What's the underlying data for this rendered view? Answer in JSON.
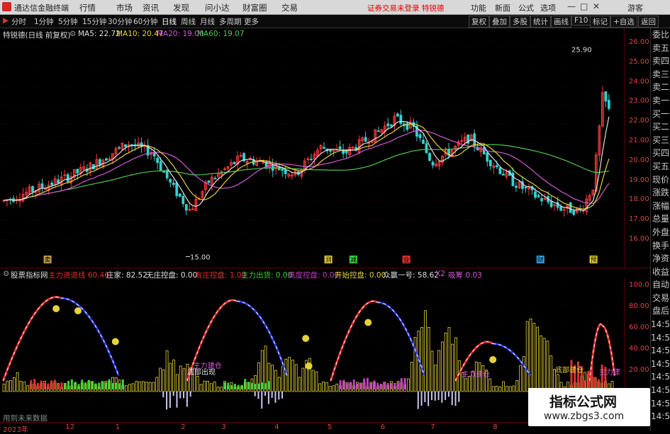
{
  "menubar": {
    "title": "通达信金融终端",
    "items": [
      "行情",
      "市场",
      "资讯",
      "发现",
      "问小达",
      "财富圈",
      "交易"
    ],
    "warning": "证券交易未登录 特锐德",
    "right": [
      "功能",
      "新面",
      "公式",
      "选项"
    ],
    "guest": "游客"
  },
  "toolbar": {
    "periods": [
      "分时",
      "1分钟",
      "5分钟",
      "15分钟",
      "30分钟",
      "60分钟",
      "日线",
      "周线",
      "月线",
      "多周期",
      "更多"
    ],
    "active": "日线",
    "right_buttons": [
      "复权",
      "叠加",
      "多股",
      "统计",
      "画线",
      "F10",
      "标记",
      "+自选",
      "返回"
    ]
  },
  "info": {
    "stock": "特锐德(日线 前复权)",
    "ma5": "MA5: 22.72",
    "ma10": "MA10: 20.47",
    "ma20": "MA20: 19.00",
    "ma60": "MA60: 19.07",
    "colors": {
      "ma5": "#e0e0e0",
      "ma10": "#e6d23a",
      "ma20": "#d35ad8",
      "ma60": "#4ec94e"
    }
  },
  "main_axis": [
    "26.00",
    "25.00",
    "24.00",
    "23.00",
    "22.00",
    "21.00",
    "20.00",
    "19.00",
    "18.00",
    "17.00",
    "16.00"
  ],
  "annotations": {
    "high": "25.90",
    "low": "15.00"
  },
  "event_marks": [
    "卖",
    "测",
    "减",
    "业",
    "财",
    "预"
  ],
  "subchart_header": {
    "name": "股票指标网",
    "items": [
      {
        "label": "主力进退线",
        "value": "60.46",
        "color": "#e03030"
      },
      {
        "label": "庄家:",
        "value": "82.52",
        "color": "#e0e0e0"
      },
      {
        "label": "无庄控盘:",
        "value": "0.00",
        "color": "#e0e0e0"
      },
      {
        "label": "有庄控盘:",
        "value": "1.00",
        "color": "#e03030"
      },
      {
        "label": "主力出货:",
        "value": "0.00",
        "color": "#3cd23c"
      },
      {
        "label": "高度控盘:",
        "value": "0.00",
        "color": "#c040c0"
      },
      {
        "label": "开始控盘:",
        "value": "0.00",
        "color": "#e6d23a"
      },
      {
        "label": "众赢一号:",
        "value": "58.62",
        "color": "#e0e0e0"
      },
      {
        "label": "X2",
        "value": "",
        "color": "#d35ad8"
      },
      {
        "label": "吸筹",
        "value": "0.03",
        "color": "#d35ad8"
      }
    ]
  },
  "sub_axis": [
    "100.0",
    "80.00",
    "60.00",
    "40.00",
    "20.00"
  ],
  "sub_texts": [
    "主力建仓",
    "底部出现",
    "主力建仓",
    "底部建仓",
    "主力建"
  ],
  "side_panel": [
    "委比",
    "卖五",
    "卖四",
    "卖三",
    "卖二",
    "卖一",
    "买一",
    "买二",
    "买三",
    "买四",
    "买五",
    "现价",
    "涨跌",
    "涨幅",
    "总量",
    "外盘",
    "换手",
    "净资",
    "收益",
    "自动",
    "交易",
    "盘后",
    "14:50",
    "14:50",
    "14:50",
    "14:50",
    "14:50",
    "14:50",
    "14:50",
    "14:50"
  ],
  "time_axis": [
    {
      "label": "2023年",
      "pos": 0.005
    },
    {
      "label": "12",
      "pos": 0.105
    },
    {
      "label": "1",
      "pos": 0.185
    },
    {
      "label": "2",
      "pos": 0.29
    },
    {
      "label": "3",
      "pos": 0.355
    },
    {
      "label": "4",
      "pos": 0.44
    },
    {
      "label": "5",
      "pos": 0.525
    },
    {
      "label": "6",
      "pos": 0.61
    },
    {
      "label": "7",
      "pos": 0.69
    },
    {
      "label": "8",
      "pos": 0.79
    }
  ],
  "hint": "用到未来数据",
  "watermark": {
    "line1": "指标公式网",
    "line2": "www.zbgs3.com"
  },
  "chart_data": {
    "type": "candlestick",
    "title": "特锐德(日线 前复权)",
    "ylim": [
      14.6,
      26.4
    ],
    "ticks": [
      16,
      17,
      18,
      19,
      20,
      21,
      22,
      23,
      24,
      25,
      26
    ],
    "series": [
      {
        "name": "MA60",
        "values": [
          18.7,
          18.85,
          18.95,
          19.05,
          19.15,
          19.3,
          19.5,
          19.55,
          19.5,
          19.6,
          19.8,
          19.95,
          20.1,
          20.25,
          20.4,
          20.6,
          20.8,
          20.85,
          20.8,
          20.7,
          20.5,
          20.1,
          19.6,
          19.3,
          19.07
        ]
      },
      {
        "name": "MA20",
        "values": [
          18.3,
          18.7,
          19.1,
          19.3,
          19.9,
          20.8,
          20.3,
          17.9,
          18.9,
          19.8,
          20.5,
          19.9,
          19.6,
          20.2,
          20.8,
          21.3,
          21.8,
          21.9,
          21.0,
          20.7,
          20.5,
          19.8,
          18.8,
          18.2,
          19.0
        ]
      }
    ]
  }
}
